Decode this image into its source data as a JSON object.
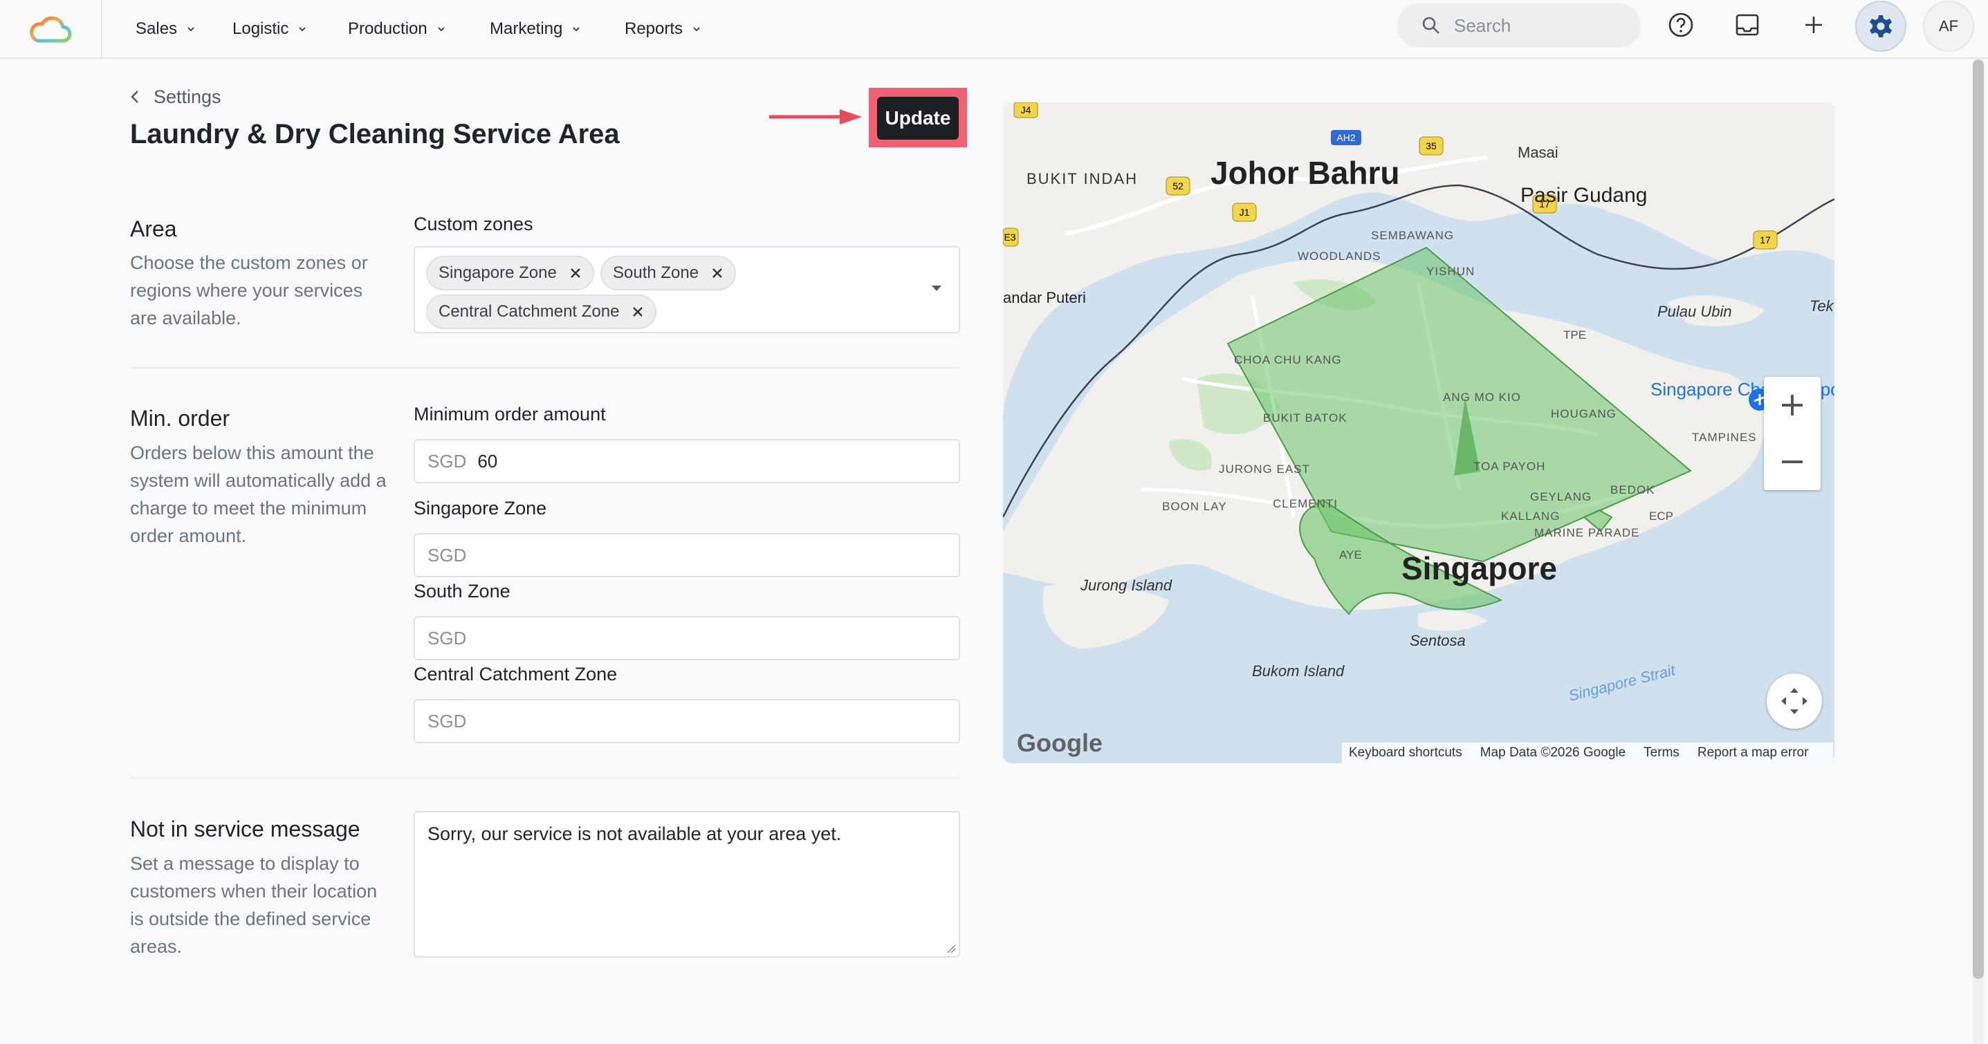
{
  "nav": {
    "items": [
      "Sales",
      "Logistic",
      "Production",
      "Marketing",
      "Reports"
    ],
    "search_placeholder": "Search",
    "avatar_initials": "AF"
  },
  "header": {
    "back_label": "Settings",
    "title": "Laundry & Dry Cleaning Service Area",
    "update_label": "Update"
  },
  "area": {
    "title": "Area",
    "description": "Choose the custom zones or regions where your services are available.",
    "field_label": "Custom zones",
    "chips": [
      "Singapore Zone",
      "South Zone",
      "Central Catchment Zone"
    ]
  },
  "min_order": {
    "title": "Min. order",
    "description": "Orders below this amount the system will automatically add a charge to meet the minimum order amount.",
    "fields": [
      {
        "label": "Minimum order amount",
        "prefix": "SGD",
        "value": "60"
      },
      {
        "label": "Singapore Zone",
        "prefix": "SGD",
        "value": ""
      },
      {
        "label": "South Zone",
        "prefix": "SGD",
        "value": ""
      },
      {
        "label": "Central Catchment Zone",
        "prefix": "SGD",
        "value": ""
      }
    ]
  },
  "not_in_service": {
    "title": "Not in service message",
    "description": "Set a message to display to customers when their location is outside the defined service areas.",
    "message": "Sorry, our service is not available at your area yet."
  },
  "map": {
    "labels": {
      "johor": "Johor Bahru",
      "pasir": "Pasir Gudang",
      "singapore": "Singapore",
      "bukit_indah": "BUKIT INDAH",
      "masai": "Masai",
      "sembawang": "SEMBAWANG",
      "woodlands": "WOODLANDS",
      "yishun": "YISHUN",
      "andar_puteri": "andar Puteri",
      "pulau_ubin": "Pulau Ubin",
      "tek": "Tek",
      "tpe": "TPE",
      "choa_chu_kang": "CHOA CHU KANG",
      "bukit_batok": "BUKIT BATOK",
      "ang_mo_kio": "ANG MO KIO",
      "hougang": "HOUGANG",
      "changi": "Singapore Changi Airport",
      "tampines": "TAMPINES",
      "jurong_east": "JURONG EAST",
      "toa_payoh": "TOA PAYOH",
      "bedok": "BEDOK",
      "boon_lay": "BOON LAY",
      "clementi": "CLEMENTI",
      "geylang": "GEYLANG",
      "kallang": "KALLANG",
      "ecp": "ECP",
      "marine_parade": "MARINE PARADE",
      "jurong_island": "Jurong Island",
      "sentosa": "Sentosa",
      "bukom": "Bukom Island",
      "strait": "Singapore Strait",
      "ayer": "AYE"
    },
    "shields": [
      "J4",
      "AH2",
      "35",
      "52",
      "J1",
      "17",
      "17",
      "E3"
    ],
    "footer": [
      "Keyboard shortcuts",
      "Map Data ©2026 Google",
      "Terms",
      "Report a map error"
    ],
    "brand": "Google",
    "zone_color": "#6cc46a"
  }
}
